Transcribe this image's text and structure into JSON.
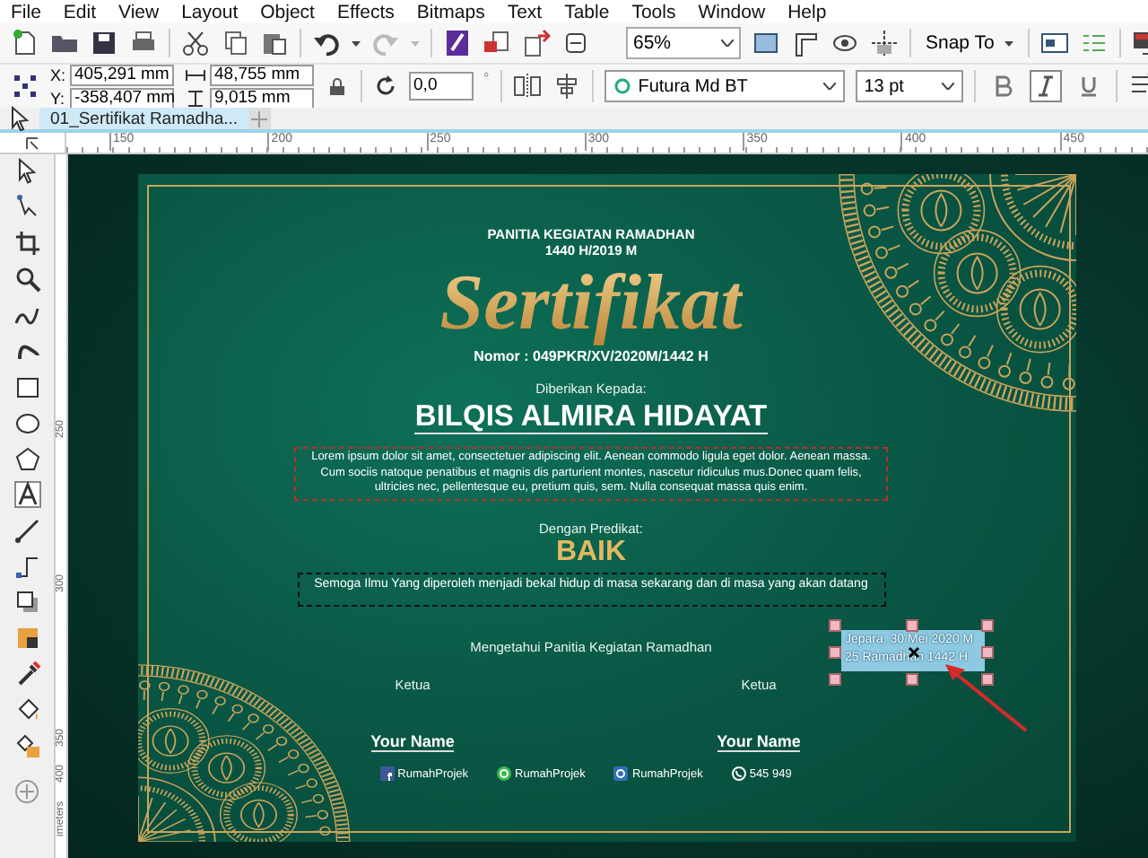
{
  "menu": [
    "File",
    "Edit",
    "View",
    "Layout",
    "Object",
    "Effects",
    "Bitmaps",
    "Text",
    "Table",
    "Tools",
    "Window",
    "Help"
  ],
  "toolbar": {
    "zoom": "65%",
    "snap": "Snap To"
  },
  "property_bar": {
    "x_label": "X:",
    "x": "405,291 mm",
    "y_label": "Y:",
    "y": "-358,407 mm",
    "width": "48,755 mm",
    "height": "9,015 mm",
    "rotation": "0,0",
    "degree": "°",
    "font": "Futura Md BT",
    "size": "13 pt",
    "bold": false,
    "italic": true,
    "underline": false
  },
  "tabs": [
    {
      "label": "01_Sertifikat Ramadha...",
      "selected": true
    }
  ],
  "rulers": {
    "horizontal": [
      "150",
      "200",
      "250",
      "300",
      "350",
      "400",
      "450"
    ],
    "vertical": [
      "250",
      "300",
      "350",
      "400"
    ],
    "unit": "imeters"
  },
  "certificate": {
    "header": "PANITIA KEGIATAN RAMADHAN",
    "year": "1440 H/2019 M",
    "title": "Sertifikat",
    "number": "Nomor : 049PKR/XV/2020M/1442 H",
    "given_to": "Diberikan Kepada:",
    "recipient": "BILQIS ALMIRA HIDAYAT",
    "body": "Lorem ipsum dolor sit amet, consectetuer adipiscing elit. Aenean commodo ligula eget dolor. Aenean massa. Cum sociis natoque penatibus et magnis dis parturient montes, nascetur ridiculus mus.Donec quam felis, ultricies nec, pellentesque eu, pretium quis, sem. Nulla consequat massa quis enim.",
    "predicate_label": "Dengan Predikat:",
    "predicate": "BAIK",
    "wish": "Semoga Ilmu Yang diperoleh menjadi bekal hidup di masa sekarang dan di masa yang akan datang",
    "acknowledge": "Mengetahui Panitia Kegiatan Ramadhan",
    "signers": [
      {
        "role": "Ketua",
        "name": "Your Name"
      },
      {
        "role": "Ketua",
        "name": "Your Name"
      }
    ],
    "date_text": {
      "selected": true,
      "lines": [
        "Jepara, 30 Mei 2020 M",
        "25 Ramadhan 1442 H"
      ]
    },
    "contacts": [
      {
        "kind": "facebook",
        "label": "RumahProjek"
      },
      {
        "kind": "whatsapp",
        "label": "RumahProjek"
      },
      {
        "kind": "instagram",
        "label": "RumahProjek"
      },
      {
        "kind": "phone",
        "label": "545 949"
      }
    ]
  }
}
